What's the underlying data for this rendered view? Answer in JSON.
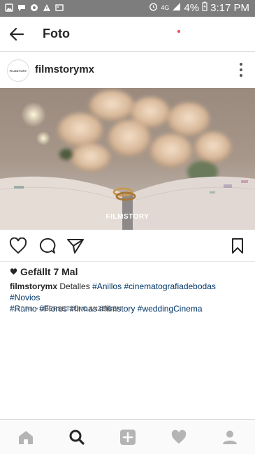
{
  "status_bar": {
    "network": "4G",
    "battery": "4%",
    "time": "3:17 PM"
  },
  "header": {
    "title": "Foto"
  },
  "post": {
    "username": "filmstorymx",
    "avatar_text": "FILMSTORY",
    "watermark": "FILMSTORY",
    "likes": "Gefällt 7 Mal",
    "caption": {
      "user": "filmstorymx",
      "text": "Detalles",
      "line1_tags": [
        "#Anillos",
        "#cinematografiadebodas",
        "#Novios"
      ],
      "line2_tags": [
        "#Ramo",
        "#Flores",
        "#firmas",
        "#filmstory",
        "#weddingCinema"
      ]
    },
    "date": "7. APRIL",
    "separator": "•",
    "translate": "ÜBERSETZUNG ANZEIGEN"
  },
  "colors": {
    "status_bar": "#7d7d7d",
    "hashtag": "#003569",
    "notification": "#ed4956"
  },
  "icons": {
    "header": [
      "back-arrow-icon"
    ],
    "actions": [
      "heart-outline-icon",
      "comment-icon",
      "share-send-icon",
      "bookmark-icon"
    ],
    "nav": [
      "home-icon",
      "search-icon",
      "add-post-icon",
      "activity-heart-icon",
      "profile-icon"
    ]
  }
}
